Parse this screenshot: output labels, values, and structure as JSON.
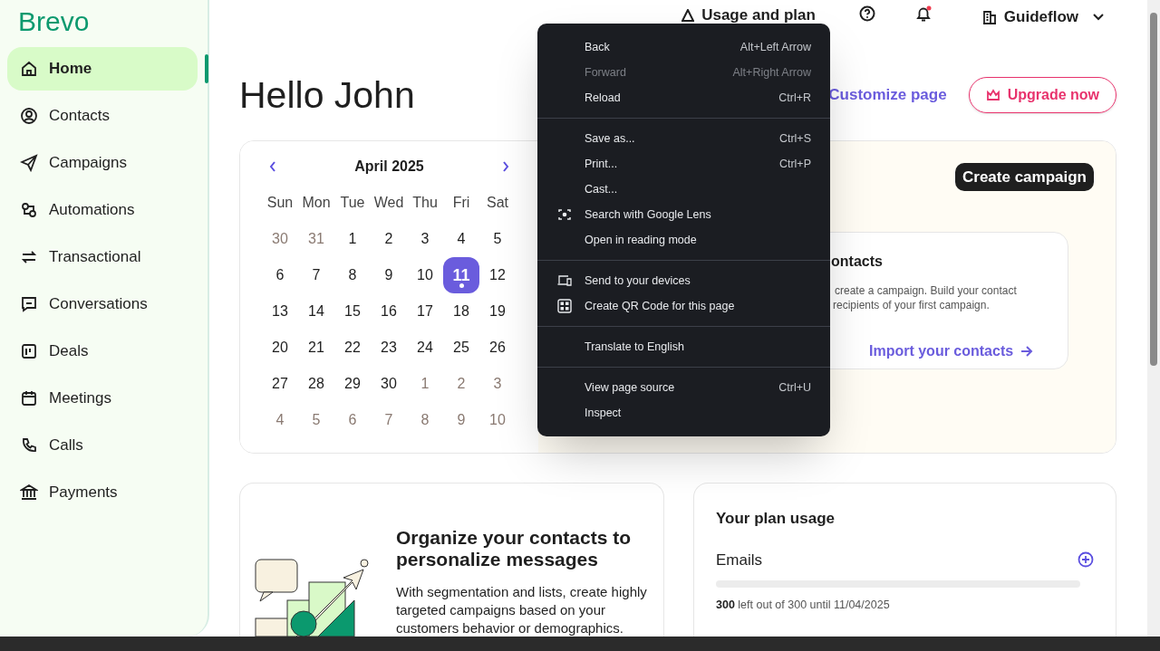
{
  "sidebar": {
    "logo": "Brevo",
    "items": [
      {
        "label": "Home",
        "selected": true
      },
      {
        "label": "Contacts",
        "selected": false
      },
      {
        "label": "Campaigns",
        "selected": false
      },
      {
        "label": "Automations",
        "selected": false
      },
      {
        "label": "Transactional",
        "selected": false
      },
      {
        "label": "Conversations",
        "selected": false
      },
      {
        "label": "Deals",
        "selected": false
      },
      {
        "label": "Meetings",
        "selected": false
      },
      {
        "label": "Calls",
        "selected": false
      },
      {
        "label": "Payments",
        "selected": false
      }
    ]
  },
  "header": {
    "usage_label": "Usage and plan",
    "account": "Guideflow",
    "has_notification": true
  },
  "greeting": "Hello John",
  "customize_link": "Customize page",
  "upgrade_button": "Upgrade now",
  "calendar": {
    "month": "April 2025",
    "weekdays": [
      "Sun",
      "Mon",
      "Tue",
      "Wed",
      "Thu",
      "Fri",
      "Sat"
    ],
    "days": [
      {
        "day": "30",
        "outside": true,
        "selected": false
      },
      {
        "day": "31",
        "outside": true,
        "selected": false
      },
      {
        "day": "1",
        "outside": false,
        "selected": false
      },
      {
        "day": "2",
        "outside": false,
        "selected": false
      },
      {
        "day": "3",
        "outside": false,
        "selected": false
      },
      {
        "day": "4",
        "outside": false,
        "selected": false
      },
      {
        "day": "5",
        "outside": false,
        "selected": false
      },
      {
        "day": "6",
        "outside": false,
        "selected": false
      },
      {
        "day": "7",
        "outside": false,
        "selected": false
      },
      {
        "day": "8",
        "outside": false,
        "selected": false
      },
      {
        "day": "9",
        "outside": false,
        "selected": false
      },
      {
        "day": "10",
        "outside": false,
        "selected": false
      },
      {
        "day": "11",
        "outside": false,
        "selected": true
      },
      {
        "day": "12",
        "outside": false,
        "selected": false
      },
      {
        "day": "13",
        "outside": false,
        "selected": false
      },
      {
        "day": "14",
        "outside": false,
        "selected": false
      },
      {
        "day": "15",
        "outside": false,
        "selected": false
      },
      {
        "day": "16",
        "outside": false,
        "selected": false
      },
      {
        "day": "17",
        "outside": false,
        "selected": false
      },
      {
        "day": "18",
        "outside": false,
        "selected": false
      },
      {
        "day": "19",
        "outside": false,
        "selected": false
      },
      {
        "day": "20",
        "outside": false,
        "selected": false
      },
      {
        "day": "21",
        "outside": false,
        "selected": false
      },
      {
        "day": "22",
        "outside": false,
        "selected": false
      },
      {
        "day": "23",
        "outside": false,
        "selected": false
      },
      {
        "day": "24",
        "outside": false,
        "selected": false
      },
      {
        "day": "25",
        "outside": false,
        "selected": false
      },
      {
        "day": "26",
        "outside": false,
        "selected": false
      },
      {
        "day": "27",
        "outside": false,
        "selected": false
      },
      {
        "day": "28",
        "outside": false,
        "selected": false
      },
      {
        "day": "29",
        "outside": false,
        "selected": false
      },
      {
        "day": "30",
        "outside": false,
        "selected": false
      },
      {
        "day": "1",
        "outside": true,
        "selected": false
      },
      {
        "day": "2",
        "outside": true,
        "selected": false
      },
      {
        "day": "3",
        "outside": true,
        "selected": false
      },
      {
        "day": "4",
        "outside": true,
        "selected": false
      },
      {
        "day": "5",
        "outside": true,
        "selected": false
      },
      {
        "day": "6",
        "outside": true,
        "selected": false
      },
      {
        "day": "7",
        "outside": true,
        "selected": false
      },
      {
        "day": "8",
        "outside": true,
        "selected": false
      },
      {
        "day": "9",
        "outside": true,
        "selected": false
      },
      {
        "day": "10",
        "outside": true,
        "selected": false
      }
    ]
  },
  "campaign_panel": {
    "create_button": "Create campaign",
    "card_title": "ontacts",
    "card_lines": [
      "create a campaign. Build your contact",
      "recipients of your first campaign."
    ],
    "card_link": "Import your contacts"
  },
  "promo_card": {
    "title": "Organize your contacts to personalize messages",
    "body": "With segmentation and lists, create highly targeted campaigns based on your customers behavior or demographics."
  },
  "plan_usage": {
    "title": "Your plan usage",
    "items": [
      {
        "label": "Emails",
        "level": 0,
        "amount": "300",
        "detail": "left out of 300 until 11/04/2025"
      }
    ]
  },
  "context_menu": {
    "groups": [
      [
        {
          "label": "Back",
          "shortcut": "Alt+Left Arrow",
          "disabled": false
        },
        {
          "label": "Forward",
          "shortcut": "Alt+Right Arrow",
          "disabled": true
        },
        {
          "label": "Reload",
          "shortcut": "Ctrl+R",
          "disabled": false
        }
      ],
      [
        {
          "label": "Save as...",
          "shortcut": "Ctrl+S",
          "disabled": false
        },
        {
          "label": "Print...",
          "shortcut": "Ctrl+P",
          "disabled": false
        },
        {
          "label": "Cast...",
          "disabled": false
        },
        {
          "label": "Search with Google Lens",
          "disabled": false
        },
        {
          "label": "Open in reading mode",
          "disabled": false
        }
      ],
      [
        {
          "label": "Send to your devices",
          "disabled": false
        },
        {
          "label": "Create QR Code for this page",
          "disabled": false
        }
      ],
      [
        {
          "label": "Translate to English",
          "disabled": false
        }
      ],
      [
        {
          "label": "View page source",
          "shortcut": "Ctrl+U",
          "disabled": false
        },
        {
          "label": "Inspect",
          "disabled": false
        }
      ]
    ]
  }
}
